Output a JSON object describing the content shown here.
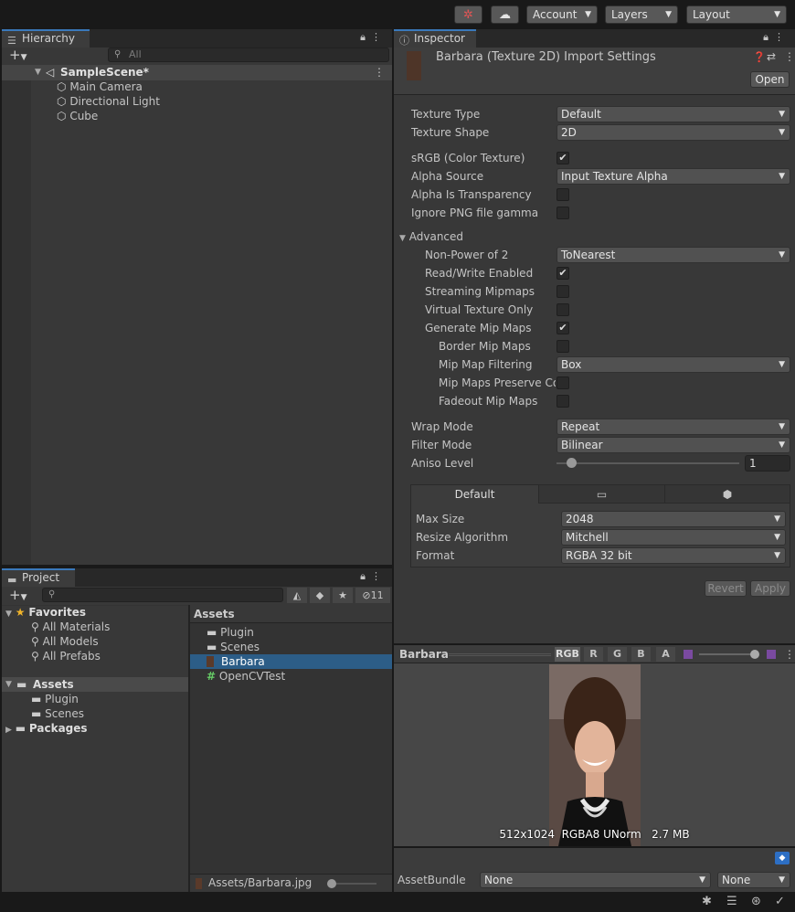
{
  "toolbar": {
    "collab_icon": "collab-icon",
    "cloud_icon": "cloud-icon",
    "account_label": "Account",
    "layers_label": "Layers",
    "layout_label": "Layout"
  },
  "hierarchy": {
    "tab_label": "Hierarchy",
    "search_placeholder": "All",
    "scene_name": "SampleScene*",
    "items": [
      {
        "label": "Main Camera"
      },
      {
        "label": "Directional Light"
      },
      {
        "label": "Cube"
      }
    ]
  },
  "project": {
    "tab_label": "Project",
    "hidden_count": "11",
    "favorites": {
      "label": "Favorites",
      "items": [
        {
          "label": "All Materials"
        },
        {
          "label": "All Models"
        },
        {
          "label": "All Prefabs"
        }
      ]
    },
    "assets_label": "Assets",
    "asset_folders": [
      {
        "label": "Plugin"
      },
      {
        "label": "Scenes"
      }
    ],
    "packages_label": "Packages",
    "breadcrumb": "Assets",
    "files": [
      {
        "label": "Plugin",
        "icon": "folder-icon"
      },
      {
        "label": "Scenes",
        "icon": "folder-icon"
      },
      {
        "label": "Barbara",
        "icon": "image-thumbnail-icon",
        "selected": true
      },
      {
        "label": "OpenCVTest",
        "icon": "csharp-script-icon"
      }
    ],
    "path": "Assets/Barbara.jpg"
  },
  "inspector": {
    "tab_label": "Inspector",
    "title": "Barbara (Texture 2D) Import Settings",
    "open_label": "Open",
    "fields": {
      "texture_type": {
        "label": "Texture Type",
        "value": "Default"
      },
      "texture_shape": {
        "label": "Texture Shape",
        "value": "2D"
      },
      "srgb": {
        "label": "sRGB (Color Texture)",
        "checked": true
      },
      "alpha_source": {
        "label": "Alpha Source",
        "value": "Input Texture Alpha"
      },
      "alpha_transparency": {
        "label": "Alpha Is Transparency",
        "checked": false
      },
      "ignore_png": {
        "label": "Ignore PNG file gamma",
        "checked": false
      },
      "advanced": {
        "label": "Advanced"
      },
      "npot": {
        "label": "Non-Power of 2",
        "value": "ToNearest"
      },
      "read_write": {
        "label": "Read/Write Enabled",
        "checked": true
      },
      "streaming_mip": {
        "label": "Streaming Mipmaps",
        "checked": false
      },
      "virtual_texture": {
        "label": "Virtual Texture Only",
        "checked": false
      },
      "gen_mip": {
        "label": "Generate Mip Maps",
        "checked": true
      },
      "border_mip": {
        "label": "Border Mip Maps",
        "checked": false
      },
      "mip_filter": {
        "label": "Mip Map Filtering",
        "value": "Box"
      },
      "mip_preserve": {
        "label": "Mip Maps Preserve Co",
        "checked": false
      },
      "fadeout_mip": {
        "label": "Fadeout Mip Maps",
        "checked": false
      },
      "wrap_mode": {
        "label": "Wrap Mode",
        "value": "Repeat"
      },
      "filter_mode": {
        "label": "Filter Mode",
        "value": "Bilinear"
      },
      "aniso": {
        "label": "Aniso Level",
        "value": "1",
        "slider_fraction": 0.06
      }
    },
    "platform": {
      "tabs": [
        {
          "label": "Default"
        },
        {
          "icon": "monitor-icon"
        },
        {
          "icon": "android-icon"
        }
      ],
      "max_size": {
        "label": "Max Size",
        "value": "2048"
      },
      "resize": {
        "label": "Resize Algorithm",
        "value": "Mitchell"
      },
      "format": {
        "label": "Format",
        "value": "RGBA 32 bit"
      }
    },
    "revert_label": "Revert",
    "apply_label": "Apply"
  },
  "preview": {
    "title": "Barbara",
    "channels": [
      "RGB",
      "R",
      "G",
      "B",
      "A"
    ],
    "info": "512x1024  RGBA8 UNorm   2.7 MB",
    "mip_slider_fraction": 1.0
  },
  "assetbundle": {
    "label": "AssetBundle",
    "name_value": "None",
    "variant_value": "None"
  },
  "colors": {
    "accent": "#3a79bb",
    "selection": "#2c5d87",
    "panel_bg": "#383838",
    "toolbar_bg": "#191919"
  }
}
